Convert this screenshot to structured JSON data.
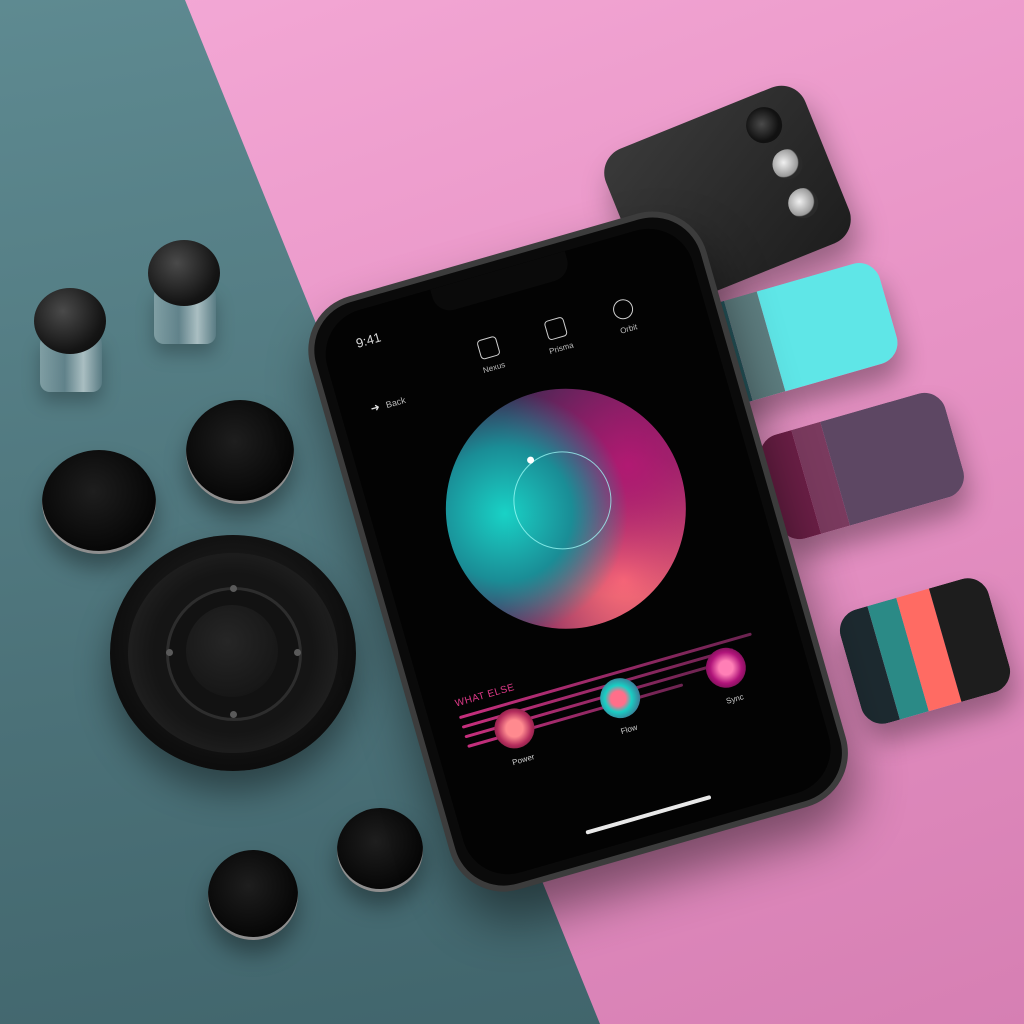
{
  "colors": {
    "background_pink": "#e894c6",
    "background_teal": "#4b7178",
    "accent_magenta": "#c62f7d",
    "accent_teal": "#19d2c6",
    "accent_coral": "#ff6f78"
  },
  "phone": {
    "status_time": "9:41",
    "top_items": [
      {
        "icon": "paper-plane-icon",
        "label": "Nexus"
      },
      {
        "icon": "gallery-icon",
        "label": "Prisma"
      },
      {
        "icon": "globe-icon",
        "label": "Orbit"
      }
    ],
    "back_label": "Back",
    "section_title": "WHAT ELSE",
    "actions": [
      {
        "icon": "coral-button",
        "label": "Power"
      },
      {
        "icon": "teal-button",
        "label": "Flow"
      },
      {
        "icon": "magenta-button",
        "label": "Sync"
      }
    ]
  },
  "gadgets": {
    "packs": [
      {
        "name": "teal-pack",
        "colors": [
          "#26575d",
          "#5e7e80",
          "#5fe6e7"
        ]
      },
      {
        "name": "purple-pack",
        "colors": [
          "#6b1f46",
          "#7a3a5e",
          "#5d4763"
        ]
      },
      {
        "name": "striped-pack",
        "colors": [
          "#1d2a30",
          "#2b8a86",
          "#ff6b63",
          "#1d1d1d"
        ]
      }
    ]
  }
}
